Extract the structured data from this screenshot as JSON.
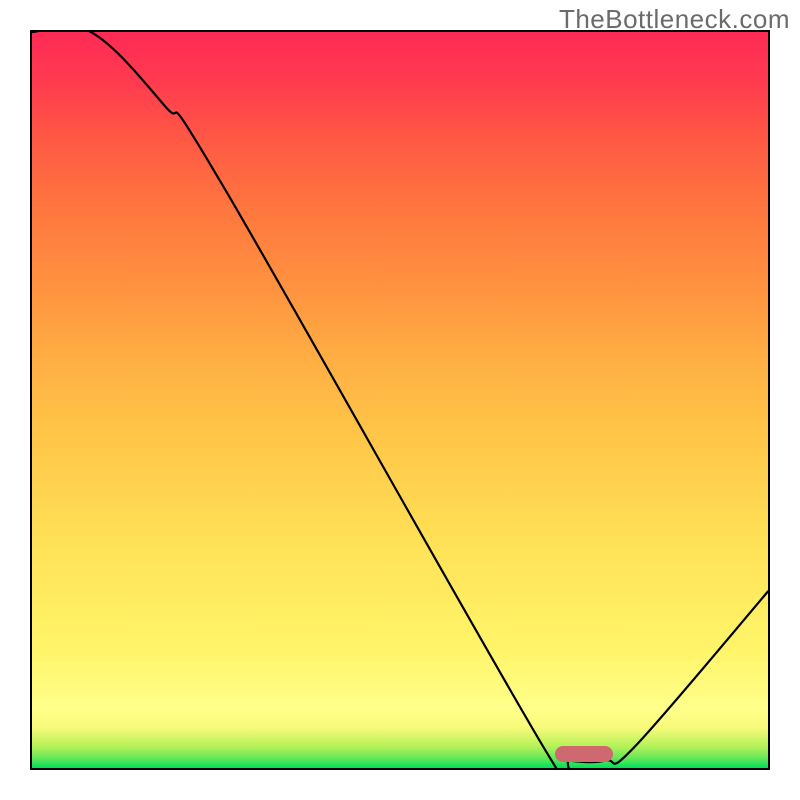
{
  "watermark": "TheBottleneck.com",
  "chart_data": {
    "type": "line",
    "title": "",
    "xlabel": "",
    "ylabel": "",
    "xlim": [
      0,
      100
    ],
    "ylim": [
      0,
      100
    ],
    "grid": false,
    "legend": false,
    "series": [
      {
        "name": "bottleneck-curve",
        "x": [
          0,
          8,
          18,
          26,
          70,
          73,
          78,
          82,
          100
        ],
        "values": [
          100,
          100,
          90,
          79,
          2,
          1,
          1,
          3,
          24
        ]
      }
    ],
    "marker": {
      "name": "optimal-region",
      "x_start": 71,
      "x_end": 79,
      "y": 0.8,
      "height": 2.2,
      "color": "#ce6a6f"
    },
    "gradient": {
      "orientation": "vertical",
      "stops": [
        {
          "pos": 0.0,
          "color": "#00e05a"
        },
        {
          "pos": 0.02,
          "color": "#6fe85a"
        },
        {
          "pos": 0.03,
          "color": "#b6f25a"
        },
        {
          "pos": 0.06,
          "color": "#f8fa7a"
        },
        {
          "pos": 0.08,
          "color": "#ffff8a"
        },
        {
          "pos": 0.16,
          "color": "#fff56a"
        },
        {
          "pos": 0.3,
          "color": "#ffe257"
        },
        {
          "pos": 0.45,
          "color": "#ffc648"
        },
        {
          "pos": 0.55,
          "color": "#ffb043"
        },
        {
          "pos": 0.65,
          "color": "#ff9340"
        },
        {
          "pos": 0.75,
          "color": "#ff793e"
        },
        {
          "pos": 0.85,
          "color": "#ff5a44"
        },
        {
          "pos": 0.93,
          "color": "#ff3b4f"
        },
        {
          "pos": 1.0,
          "color": "#ff2a55"
        }
      ]
    }
  }
}
